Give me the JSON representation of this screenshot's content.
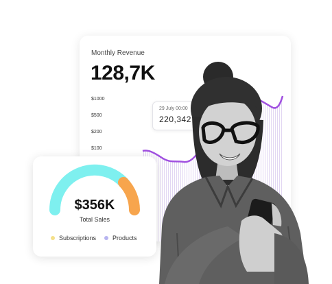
{
  "revenue": {
    "title": "Monthly Revenue",
    "value": "128,7K",
    "axis": [
      "$1000",
      "$500",
      "$200",
      "$100"
    ],
    "tooltip": {
      "date": "29 July 00:00",
      "value": "220,342"
    },
    "line_color": "#a04fe0"
  },
  "sales": {
    "value": "$356K",
    "label": "Total Sales",
    "legend": [
      {
        "label": "Subscriptions",
        "color": "#f4e08a"
      },
      {
        "label": "Products",
        "color": "#b7b4f0"
      }
    ],
    "gauge_colors": {
      "subscriptions": "#7ef0ef",
      "products": "#f7a54d"
    }
  }
}
